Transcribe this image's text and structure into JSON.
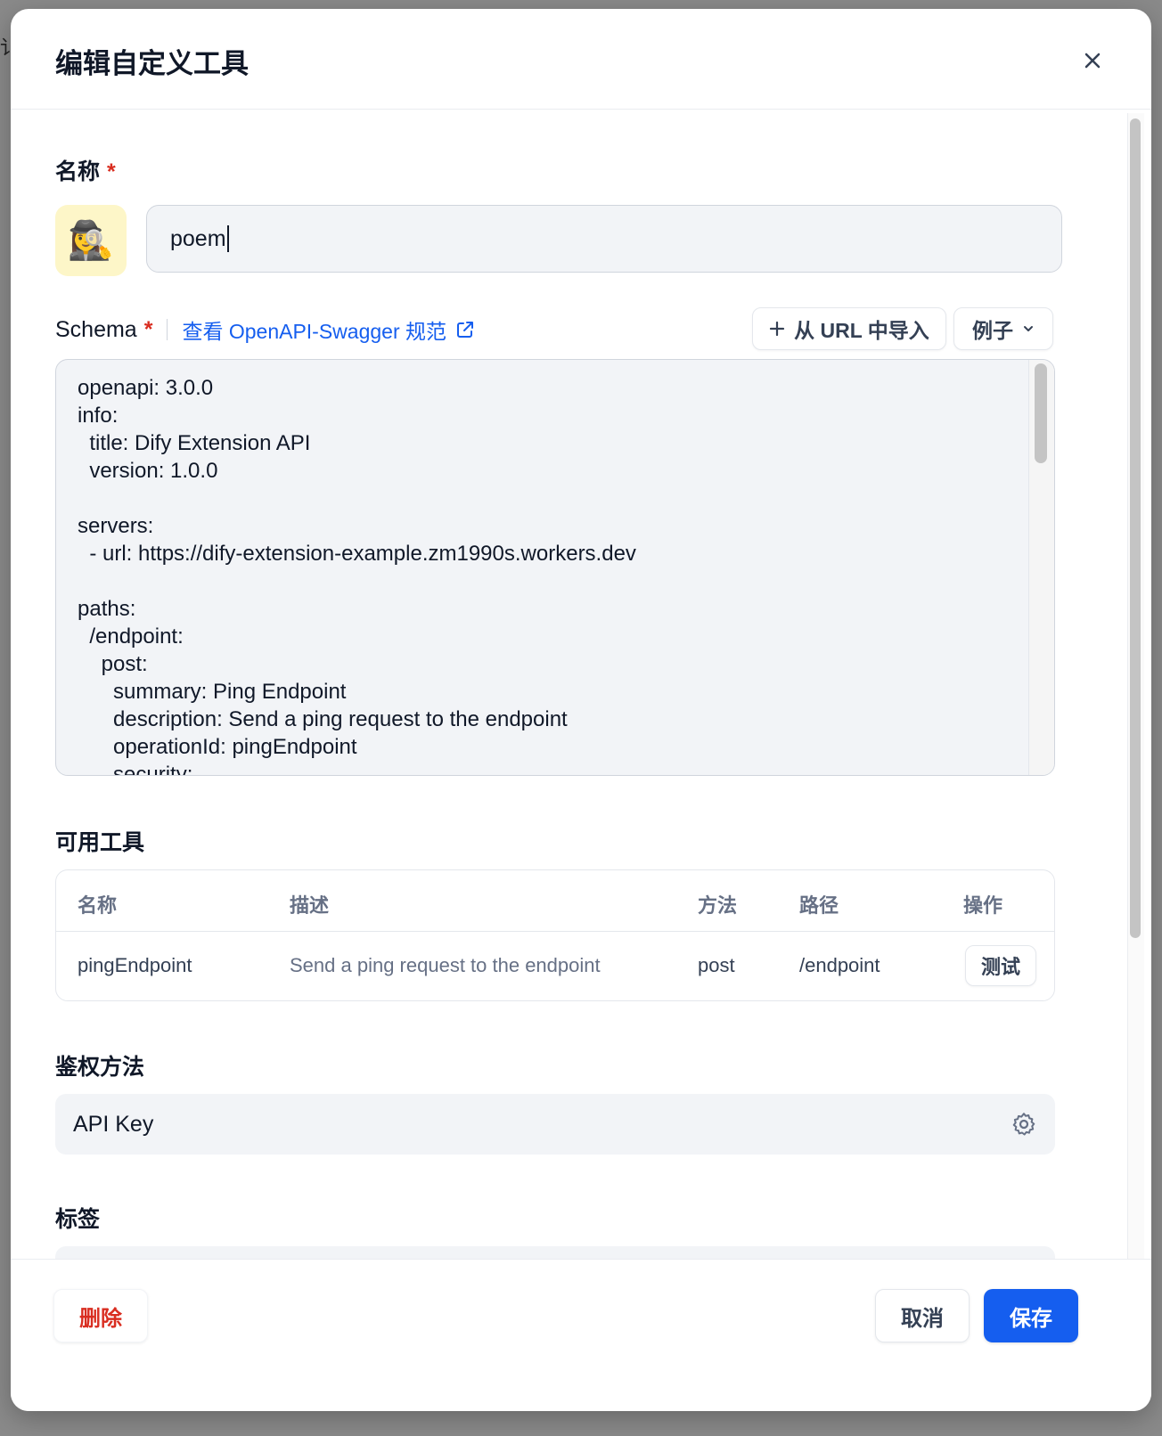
{
  "modal": {
    "title": "编辑自定义工具",
    "close_icon": "close-icon"
  },
  "name_section": {
    "label": "名称",
    "required_mark": "*",
    "emoji": "🕵️‍♀️",
    "emoji_bg": "#fdf6c8",
    "value": "poem"
  },
  "schema_section": {
    "label": "Schema",
    "required_mark": "*",
    "spec_link": "查看 OpenAPI-Swagger 规范",
    "import_button": "从 URL 中导入",
    "example_button": "例子",
    "code": "openapi: 3.0.0\ninfo:\n  title: Dify Extension API\n  version: 1.0.0\n\nservers:\n  - url: https://dify-extension-example.zm1990s.workers.dev\n\npaths:\n  /endpoint:\n    post:\n      summary: Ping Endpoint\n      description: Send a ping request to the endpoint\n      operationId: pingEndpoint\n      security:"
  },
  "tools_section": {
    "label": "可用工具",
    "columns": [
      "名称",
      "描述",
      "方法",
      "路径",
      "操作"
    ],
    "rows": [
      {
        "name": "pingEndpoint",
        "description": "Send a ping request to the endpoint",
        "method": "post",
        "path": "/endpoint",
        "action": "测试"
      }
    ]
  },
  "auth_section": {
    "label": "鉴权方法",
    "value": "API Key"
  },
  "tags_section": {
    "label": "标签"
  },
  "footer": {
    "delete_button": "删除",
    "cancel_button": "取消",
    "save_button": "保存"
  },
  "colors": {
    "primary": "#155eef",
    "danger": "#d92d20",
    "field_bg": "#f2f4f7"
  }
}
